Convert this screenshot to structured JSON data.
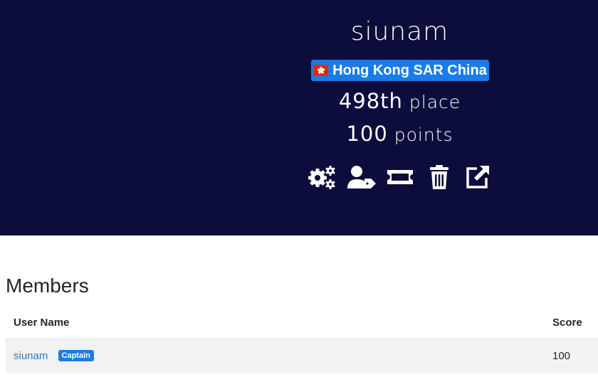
{
  "team": {
    "name": "siunam",
    "country": "Hong Kong SAR China",
    "place_number": "498th",
    "place_label": "place",
    "points_number": "100",
    "points_label": "points"
  },
  "actions": [
    {
      "icon": "settings-gears-icon"
    },
    {
      "icon": "user-tag-icon"
    },
    {
      "icon": "ticket-icon"
    },
    {
      "icon": "trash-icon"
    },
    {
      "icon": "external-link-icon"
    }
  ],
  "members": {
    "heading": "Members",
    "columns": {
      "user": "User Name",
      "score": "Score"
    },
    "rows": [
      {
        "name": "siunam",
        "badge": "Captain",
        "score": "100"
      }
    ]
  },
  "colors": {
    "header_bg": "#0c0d3c",
    "accent": "#1b7be8",
    "link": "#2c7bbf"
  }
}
